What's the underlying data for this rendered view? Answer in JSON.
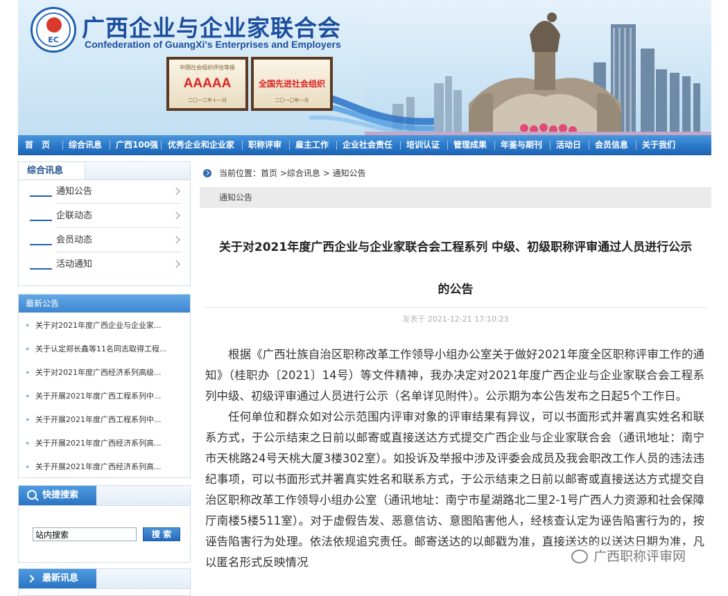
{
  "header": {
    "title": "广西企业与企业家联合会",
    "subtitle": "Confederation of GuangXi's Enterprises and Employers",
    "logo_text": "EC",
    "plaque_left": {
      "top": "中国社会组织评估等级",
      "big": "AAAAA",
      "bottom": "二〇一二年十一月"
    },
    "plaque_right": {
      "top": "",
      "big": "全国先进社会组织",
      "bottom": "二〇一〇年一月"
    }
  },
  "nav": [
    "首　页",
    "综合讯息",
    "广西100强",
    "优秀企业和企业家",
    "职称评审",
    "雇主工作",
    "企业社会责任",
    "培训认证",
    "管理成果",
    "年鉴与期刊",
    "活动日",
    "会员信息",
    "关于我们"
  ],
  "sidebar": {
    "news_tab": "综合讯息",
    "news_items": [
      "通知公告",
      "企联动态",
      "会员动态",
      "活动通知"
    ],
    "latest_title": "最新公告",
    "latest_items": [
      "关于对2021年度广西企业与企业家...",
      "关于认定郑长鑫等11名同志取得工程...",
      "关于对2021年度广西经济系列高级...",
      "关于开展2021年度广西工程系列中...",
      "关于开展2021年度广西工程系列中...",
      "关于开展2021年度广西经济系列高...",
      "关于开展2021年度广西经济系列高..."
    ],
    "search_title": "快捷搜索",
    "search_value": "站内搜索",
    "search_button": "搜 索",
    "latest2_title": "最新讯息"
  },
  "breadcrumb": {
    "prefix": "当前位置：",
    "home": "首页",
    "sep1": " >",
    "level1": "综合讯息",
    "sep2": " > ",
    "level2": "通知公告"
  },
  "section_title": "通知公告",
  "article": {
    "title_line1": "关于对2021年度广西企业与企业家联合会工程系列 中级、初级职称评审通过人员进行公示",
    "title_line2": "的公告",
    "date_label": "发表于",
    "date": "2021-12-21 17:10:23",
    "paragraphs": [
      "根据《广西壮族自治区职称改革工作领导小组办公室关于做好2021年度全区职称评审工作的通知》（桂职办〔2021〕14号）等文件精神，我办决定对2021年度广西企业与企业家联合会工程系列中级、初级评审通过人员进行公示（名单详见附件）。公示期为本公告发布之日起5个工作日。",
      "任何单位和群众如对公示范围内评审对象的评审结果有异议，可以书面形式并署真实姓名和联系方式，于公示结束之日前以邮寄或直接送达方式提交广西企业与企业家联合会（通讯地址：南宁市天桃路24号天桃大厦3楼302室）。如投诉及举报中涉及评委会成员及我会职改工作人员的违法违纪事项，可以书面形式并署真实姓名和联系方式，于公示结束之日前以邮寄或直接送达方式提交自治区职称改革工作领导小组办公室（通讯地址：南宁市星湖路北二里2-1号广西人力资源和社会保障厅南楼5楼511室）。对于虚假告发、恶意信访、意图陷害他人，经核查认定为诬告陷害行为的，按诬告陷害行为处理。依法依规追究责任。邮寄送达的以邮戳为准，直接送达的以送达日期为准，凡以匿名形式反映情况"
    ]
  },
  "watermark": "广西职称评审网",
  "colors": {
    "brand_blue": "#1c4e9d",
    "nav_blue": "#2b78c9",
    "accent_red": "#d22"
  }
}
